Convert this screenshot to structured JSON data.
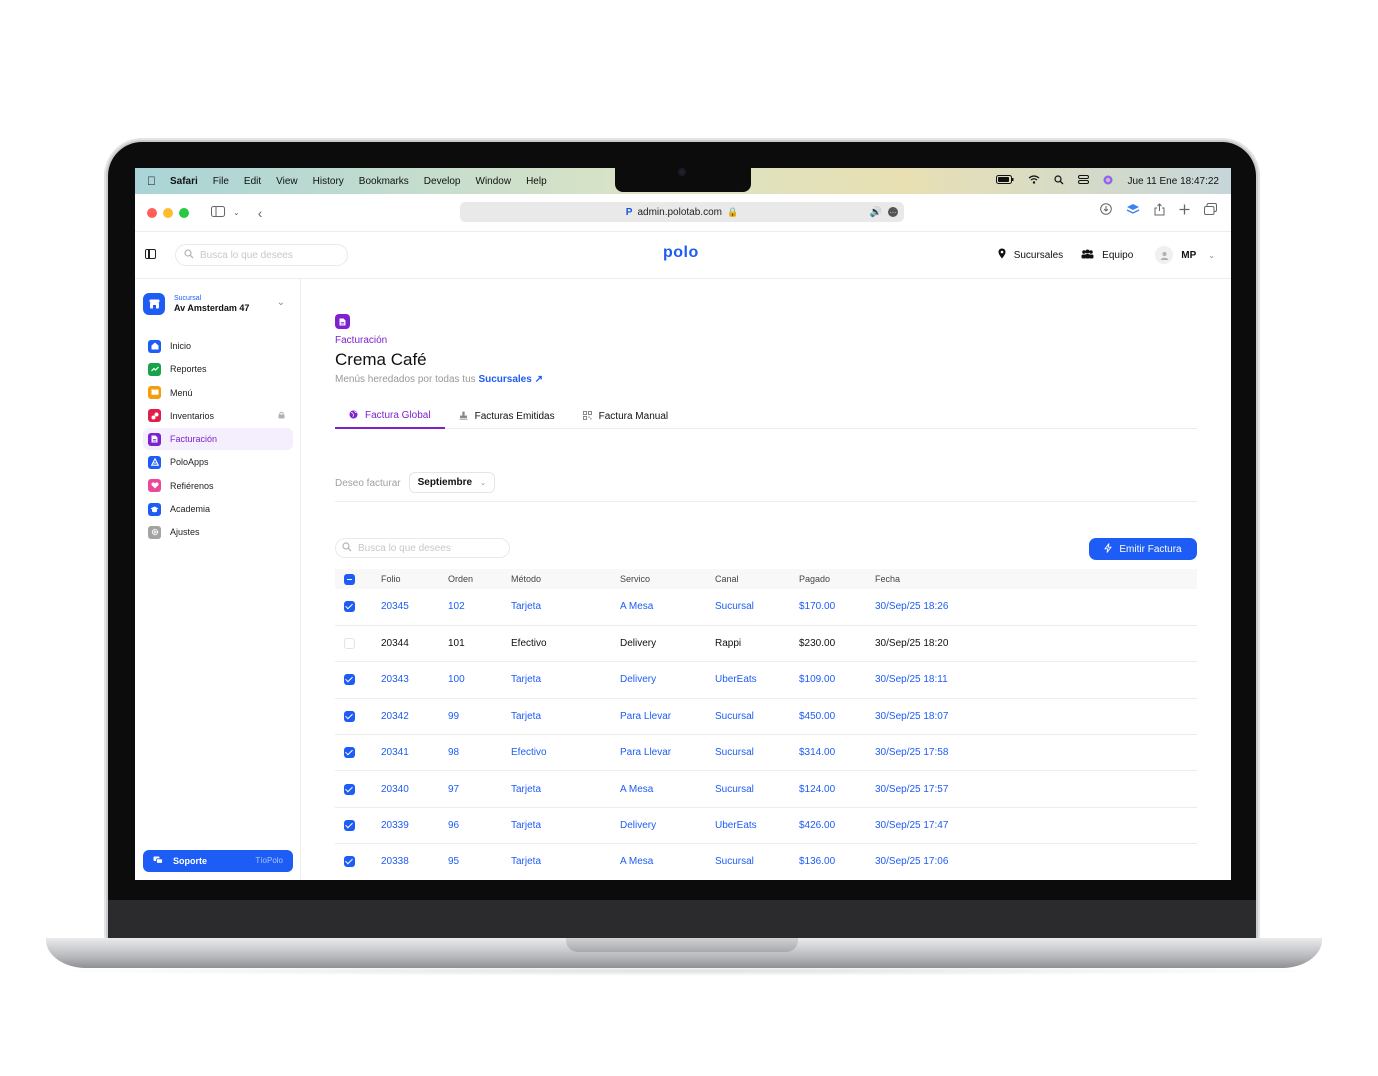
{
  "menubar": {
    "app": "Safari",
    "items": [
      "File",
      "Edit",
      "View",
      "History",
      "Bookmarks",
      "Develop",
      "Window",
      "Help"
    ],
    "datetime": "Jue 11 Ene  18:47:22"
  },
  "browser": {
    "url": "admin.polotab.com"
  },
  "header": {
    "search_placeholder": "Busca lo que desees",
    "logo": "polo",
    "branches_label": "Sucursales",
    "team_label": "Equipo",
    "user_initials": "MP"
  },
  "sidebar": {
    "branch_label": "Sucursal",
    "branch_name": "Av Amsterdam 47",
    "items": [
      {
        "label": "Inicio",
        "color": "#1d5cf5"
      },
      {
        "label": "Reportes",
        "color": "#16a34a"
      },
      {
        "label": "Menú",
        "color": "#f59e0b"
      },
      {
        "label": "Inventarios",
        "color": "#e11d48"
      },
      {
        "label": "Facturación",
        "color": "#7e22ce"
      },
      {
        "label": "PoloApps",
        "color": "#1d5cf5"
      },
      {
        "label": "Refiérenos",
        "color": "#ec4899"
      },
      {
        "label": "Academia",
        "color": "#1d5cf5"
      },
      {
        "label": "Ajustes",
        "color": "#a3a3a3"
      }
    ],
    "support_label": "Soporte",
    "support_tag": "TíoPolo"
  },
  "page": {
    "section": "Facturación",
    "title": "Crema Café",
    "subtitle": "Menús heredados por todas tus",
    "subtitle_link": "Sucursales ↗",
    "tabs": [
      "Factura Global",
      "Facturas Emitidas",
      "Factura Manual"
    ],
    "filter_label": "Deseo facturar",
    "filter_value": "Septiembre",
    "table_search_placeholder": "Busca lo que desees",
    "emit_button": "Emitir Factura"
  },
  "table": {
    "columns": [
      "Folio",
      "Orden",
      "Método",
      "Servico",
      "Canal",
      "Pagado",
      "Fecha"
    ],
    "rows": [
      {
        "selected": true,
        "cells": [
          "20345",
          "102",
          "Tarjeta",
          "A Mesa",
          "Sucursal",
          "$170.00",
          "30/Sep/25 18:26"
        ]
      },
      {
        "selected": false,
        "cells": [
          "20344",
          "101",
          "Efectivo",
          "Delivery",
          "Rappi",
          "$230.00",
          "30/Sep/25 18:20"
        ]
      },
      {
        "selected": true,
        "cells": [
          "20343",
          "100",
          "Tarjeta",
          "Delivery",
          "UberEats",
          "$109.00",
          "30/Sep/25 18:11"
        ]
      },
      {
        "selected": true,
        "cells": [
          "20342",
          "99",
          "Tarjeta",
          "Para Llevar",
          "Sucursal",
          "$450.00",
          "30/Sep/25 18:07"
        ]
      },
      {
        "selected": true,
        "cells": [
          "20341",
          "98",
          "Efectivo",
          "Para Llevar",
          "Sucursal",
          "$314.00",
          "30/Sep/25 17:58"
        ]
      },
      {
        "selected": true,
        "cells": [
          "20340",
          "97",
          "Tarjeta",
          "A Mesa",
          "Sucursal",
          "$124.00",
          "30/Sep/25 17:57"
        ]
      },
      {
        "selected": true,
        "cells": [
          "20339",
          "96",
          "Tarjeta",
          "Delivery",
          "UberEats",
          "$426.00",
          "30/Sep/25 17:47"
        ]
      },
      {
        "selected": true,
        "cells": [
          "20338",
          "95",
          "Tarjeta",
          "A Mesa",
          "Sucursal",
          "$136.00",
          "30/Sep/25 17:06"
        ]
      }
    ]
  }
}
